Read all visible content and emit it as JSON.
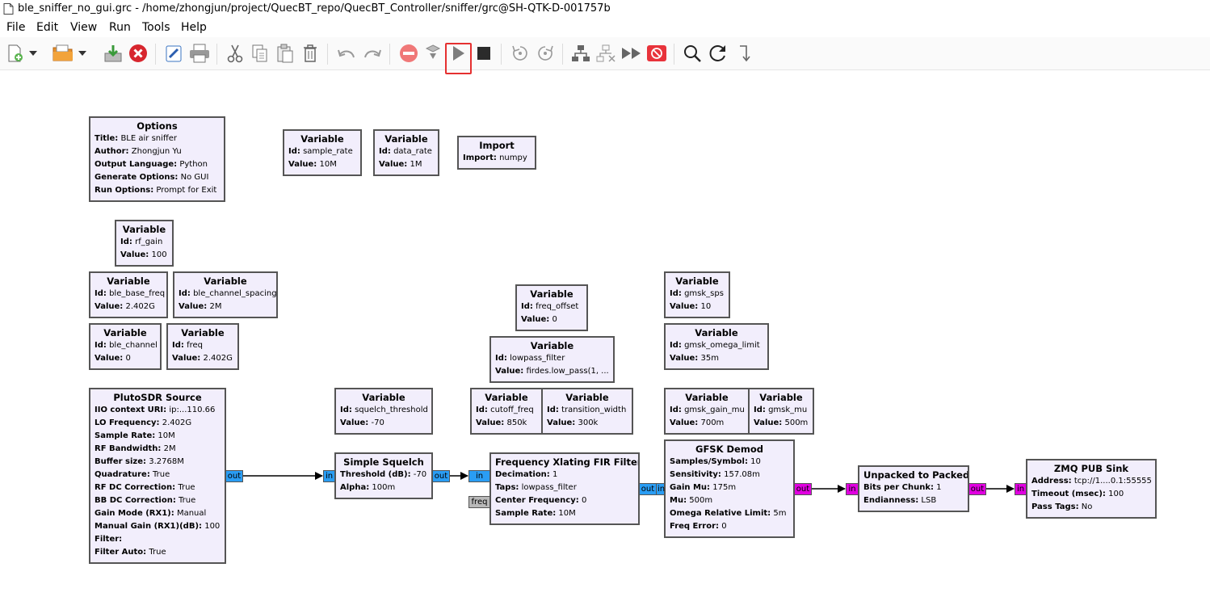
{
  "window": {
    "title": "ble_sniffer_no_gui.grc - /home/zhongjun/project/QuecBT_repo/QuecBT_Controller/sniffer/grc@SH-QTK-D-001757b"
  },
  "menu": {
    "items": [
      "File",
      "Edit",
      "View",
      "Run",
      "Tools",
      "Help"
    ]
  },
  "toolbar": {
    "buttons": [
      "new-icon",
      "dropdown-icon",
      "open-icon",
      "dropdown-icon",
      "save-icon",
      "close-icon",
      "edit-icon",
      "print-icon",
      "cut-icon",
      "copy-icon",
      "paste-icon",
      "delete-icon",
      "undo-icon",
      "redo-icon",
      "disable-icon",
      "generate-icon",
      "execute-icon",
      "stop-icon",
      "rotate-ccw-icon",
      "rotate-cw-icon",
      "enable-block-icon",
      "disable-block-icon",
      "bypass-icon",
      "kill-icon",
      "find-icon",
      "reload-icon",
      "connect-icon"
    ],
    "highlighted": "execute-icon",
    "highlight_color": "#e53030"
  },
  "colors": {
    "block_bg": "#f2eefc",
    "port_complex": "#2a9df4",
    "port_byte": "#e000e0",
    "port_msg": "#b9b9b9"
  },
  "blocks": {
    "options": {
      "title": "Options",
      "rows": [
        [
          "Title:",
          "BLE air sniffer"
        ],
        [
          "Author:",
          "Zhongjun Yu"
        ],
        [
          "Output Language:",
          "Python"
        ],
        [
          "Generate Options:",
          "No GUI"
        ],
        [
          "Run Options:",
          "Prompt for Exit"
        ]
      ]
    },
    "var_sample_rate": {
      "title": "Variable",
      "rows": [
        [
          "Id:",
          "sample_rate"
        ],
        [
          "Value:",
          "10M"
        ]
      ]
    },
    "var_data_rate": {
      "title": "Variable",
      "rows": [
        [
          "Id:",
          "data_rate"
        ],
        [
          "Value:",
          "1M"
        ]
      ]
    },
    "import": {
      "title": "Import",
      "rows": [
        [
          "Import:",
          "numpy"
        ]
      ]
    },
    "var_rf_gain": {
      "title": "Variable",
      "rows": [
        [
          "Id:",
          "rf_gain"
        ],
        [
          "Value:",
          "100"
        ]
      ]
    },
    "var_ble_base_freq": {
      "title": "Variable",
      "rows": [
        [
          "Id:",
          "ble_base_freq"
        ],
        [
          "Value:",
          "2.402G"
        ]
      ]
    },
    "var_ble_channel_spacing": {
      "title": "Variable",
      "rows": [
        [
          "Id:",
          "ble_channel_spacing"
        ],
        [
          "Value:",
          "2M"
        ]
      ]
    },
    "var_ble_channel": {
      "title": "Variable",
      "rows": [
        [
          "Id:",
          "ble_channel"
        ],
        [
          "Value:",
          "0"
        ]
      ]
    },
    "var_freq": {
      "title": "Variable",
      "rows": [
        [
          "Id:",
          "freq"
        ],
        [
          "Value:",
          "2.402G"
        ]
      ]
    },
    "var_freq_offset": {
      "title": "Variable",
      "rows": [
        [
          "Id:",
          "freq_offset"
        ],
        [
          "Value:",
          "0"
        ]
      ]
    },
    "var_lowpass_filter": {
      "title": "Variable",
      "rows": [
        [
          "Id:",
          "lowpass_filter"
        ],
        [
          "Value:",
          "firdes.low_pass(1, ..."
        ]
      ]
    },
    "var_gmsk_sps": {
      "title": "Variable",
      "rows": [
        [
          "Id:",
          "gmsk_sps"
        ],
        [
          "Value:",
          "10"
        ]
      ]
    },
    "var_gmsk_omega_limit": {
      "title": "Variable",
      "rows": [
        [
          "Id:",
          "gmsk_omega_limit"
        ],
        [
          "Value:",
          "35m"
        ]
      ]
    },
    "var_squelch_threshold": {
      "title": "Variable",
      "rows": [
        [
          "Id:",
          "squelch_threshold"
        ],
        [
          "Value:",
          "-70"
        ]
      ]
    },
    "var_cutoff_freq": {
      "title": "Variable",
      "rows": [
        [
          "Id:",
          "cutoff_freq"
        ],
        [
          "Value:",
          "850k"
        ]
      ]
    },
    "var_transition_width": {
      "title": "Variable",
      "rows": [
        [
          "Id:",
          "transition_width"
        ],
        [
          "Value:",
          "300k"
        ]
      ]
    },
    "var_gmsk_gain_mu": {
      "title": "Variable",
      "rows": [
        [
          "Id:",
          "gmsk_gain_mu"
        ],
        [
          "Value:",
          "700m"
        ]
      ]
    },
    "var_gmsk_mu": {
      "title": "Variable",
      "rows": [
        [
          "Id:",
          "gmsk_mu"
        ],
        [
          "Value:",
          "500m"
        ]
      ]
    },
    "pluto_source": {
      "title": "PlutoSDR Source",
      "rows": [
        [
          "IIO context URI:",
          "ip:...110.66"
        ],
        [
          "LO Frequency:",
          "2.402G"
        ],
        [
          "Sample Rate:",
          "10M"
        ],
        [
          "RF Bandwidth:",
          "2M"
        ],
        [
          "Buffer size:",
          "3.2768M"
        ],
        [
          "Quadrature:",
          "True"
        ],
        [
          "RF DC Correction:",
          "True"
        ],
        [
          "BB DC Correction:",
          "True"
        ],
        [
          "Gain Mode (RX1):",
          "Manual"
        ],
        [
          "Manual Gain (RX1)(dB):",
          "100"
        ],
        [
          "Filter:",
          ""
        ],
        [
          "Filter Auto:",
          "True"
        ]
      ]
    },
    "simple_squelch": {
      "title": "Simple Squelch",
      "rows": [
        [
          "Threshold (dB):",
          "-70"
        ],
        [
          "Alpha:",
          "100m"
        ]
      ]
    },
    "freq_xlating": {
      "title": "Frequency Xlating FIR Filter",
      "rows": [
        [
          "Decimation:",
          "1"
        ],
        [
          "Taps:",
          "lowpass_filter"
        ],
        [
          "Center Frequency:",
          "0"
        ],
        [
          "Sample Rate:",
          "10M"
        ]
      ]
    },
    "gfsk_demod": {
      "title": "GFSK Demod",
      "rows": [
        [
          "Samples/Symbol:",
          "10"
        ],
        [
          "Sensitivity:",
          "157.08m"
        ],
        [
          "Gain Mu:",
          "175m"
        ],
        [
          "Mu:",
          "500m"
        ],
        [
          "Omega Relative Limit:",
          "5m"
        ],
        [
          "Freq Error:",
          "0"
        ]
      ]
    },
    "unpacked_to_packed": {
      "title": "Unpacked to Packed",
      "rows": [
        [
          "Bits per Chunk:",
          "1"
        ],
        [
          "Endianness:",
          "LSB"
        ]
      ]
    },
    "zmq_pub_sink": {
      "title": "ZMQ PUB Sink",
      "rows": [
        [
          "Address:",
          "tcp://1....0.1:55555"
        ],
        [
          "Timeout (msec):",
          "100"
        ],
        [
          "Pass Tags:",
          "No"
        ]
      ]
    }
  },
  "ports": {
    "out": "out",
    "in": "in",
    "freq": "freq"
  }
}
